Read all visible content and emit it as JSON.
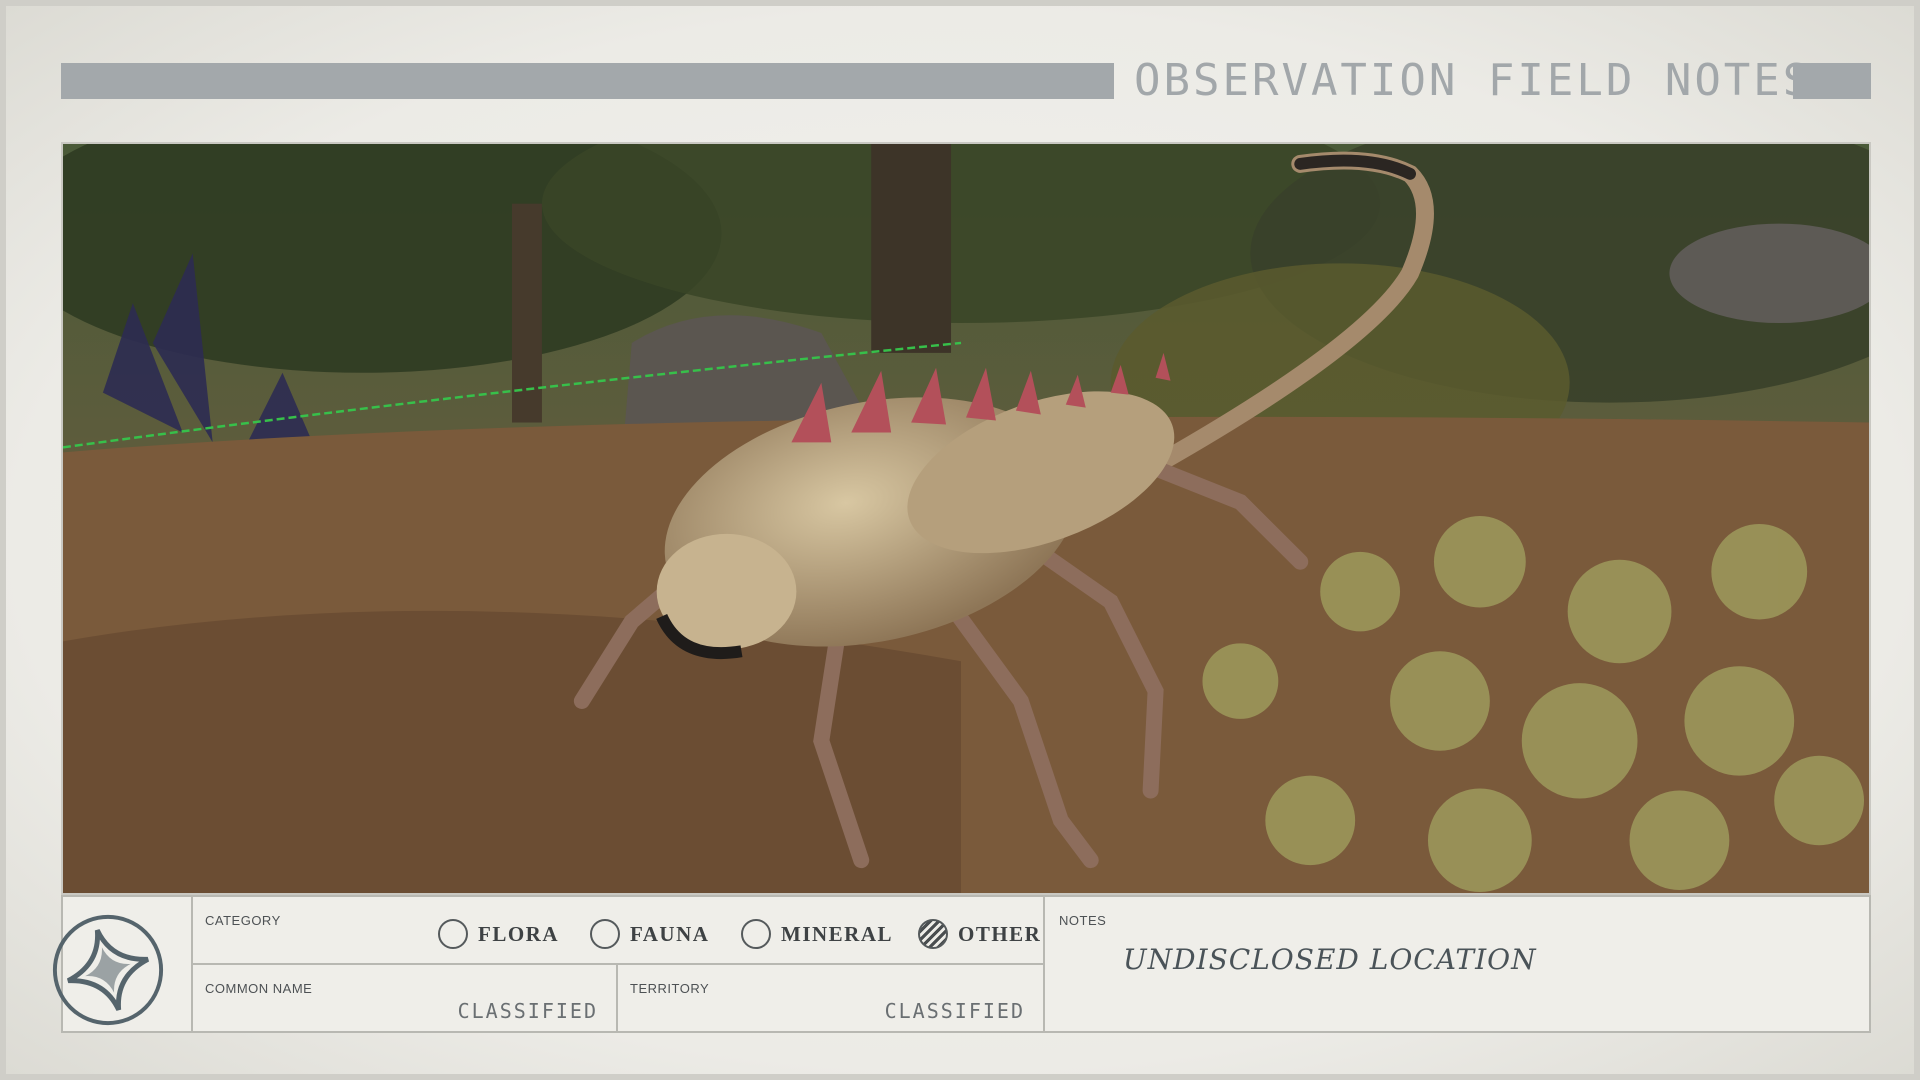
{
  "header": {
    "title": "OBSERVATION FIELD NOTES"
  },
  "photo": {
    "subject": "creature-screenshot"
  },
  "category": {
    "label": "CATEGORY",
    "options": [
      {
        "label": "FLORA",
        "checked": false
      },
      {
        "label": "FAUNA",
        "checked": false
      },
      {
        "label": "MINERAL",
        "checked": false
      },
      {
        "label": "OTHER",
        "checked": true
      }
    ]
  },
  "common_name": {
    "label": "COMMON NAME",
    "value": "CLASSIFIED"
  },
  "territory": {
    "label": "TERRITORY",
    "value": "CLASSIFIED"
  },
  "notes": {
    "label": "NOTES",
    "text": "UNDISCLOSED LOCATION"
  },
  "colors": {
    "bar": "#a3a8ab",
    "paper": "#efeee9",
    "ink": "#3e4244"
  }
}
